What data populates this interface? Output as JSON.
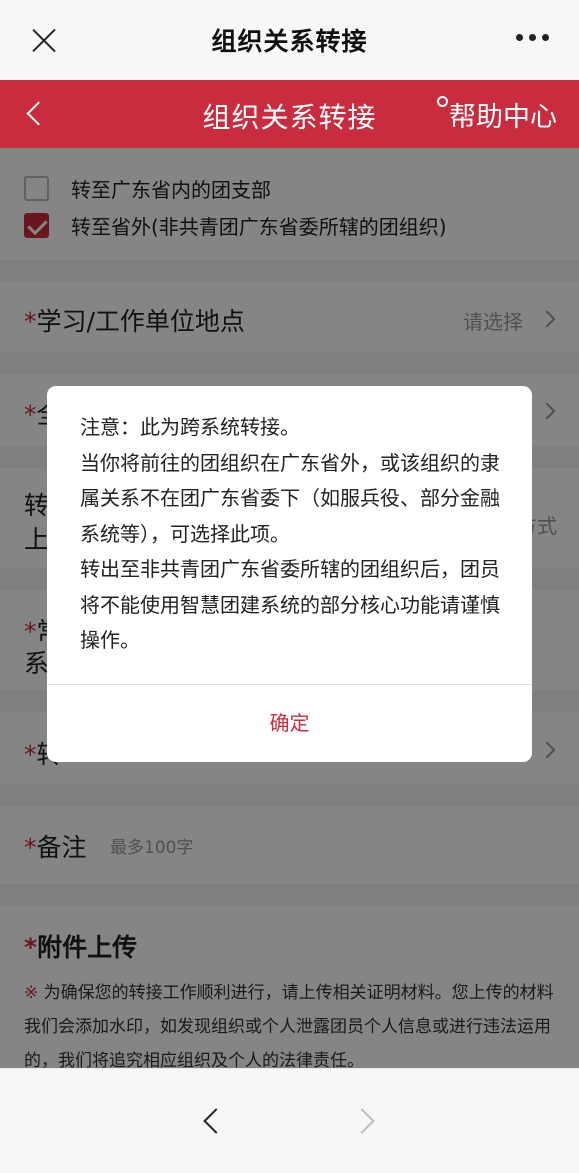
{
  "wechat_bar": {
    "title": "组织关系转接"
  },
  "header": {
    "title": "组织关系转接",
    "help_label": "帮助中心"
  },
  "options": [
    {
      "label": "转至广东省内的团支部",
      "checked": false
    },
    {
      "label": "转至省外(非共青团广东省委所辖的团组织)",
      "checked": true
    }
  ],
  "form": {
    "required_mark": "*",
    "location_label": "学习/工作单位地点",
    "location_value": "请选择",
    "row2_label_fragment": "全",
    "row3_label_line1": "转",
    "row3_label_line2": "上",
    "row3_value_fragment": "方式",
    "row4_label_line1": "常",
    "row4_label_line2": "系",
    "row5_label_fragment": "转",
    "remark_label": "备注",
    "remark_placeholder": "最多100字"
  },
  "attachments": {
    "title": "附件上传",
    "mark": "※",
    "notice": " 为确保您的转接工作顺利进行，请上传相关证明材料。您上传的材料我们会添加水印，如发现组织或个人泄露团员个人信息或进行违法运用的，我们将追究相应组织及个人的法律责任。"
  },
  "dialog": {
    "line1": "注意：此为跨系统转接。",
    "line2": "当你将前往的团组织在广东省外，或该组织的隶属关系不在团广东省委下（如服兵役、部分金融系统等），可选择此项。",
    "line3": "转出至非共青团广东省委所辖的团组织后，团员将不能使用智慧团建系统的部分核心功能请谨慎操作。",
    "confirm_label": "确定"
  },
  "colors": {
    "brand_red": "#c82c3e",
    "overlay": "rgba(0,0,0,0.48)"
  }
}
